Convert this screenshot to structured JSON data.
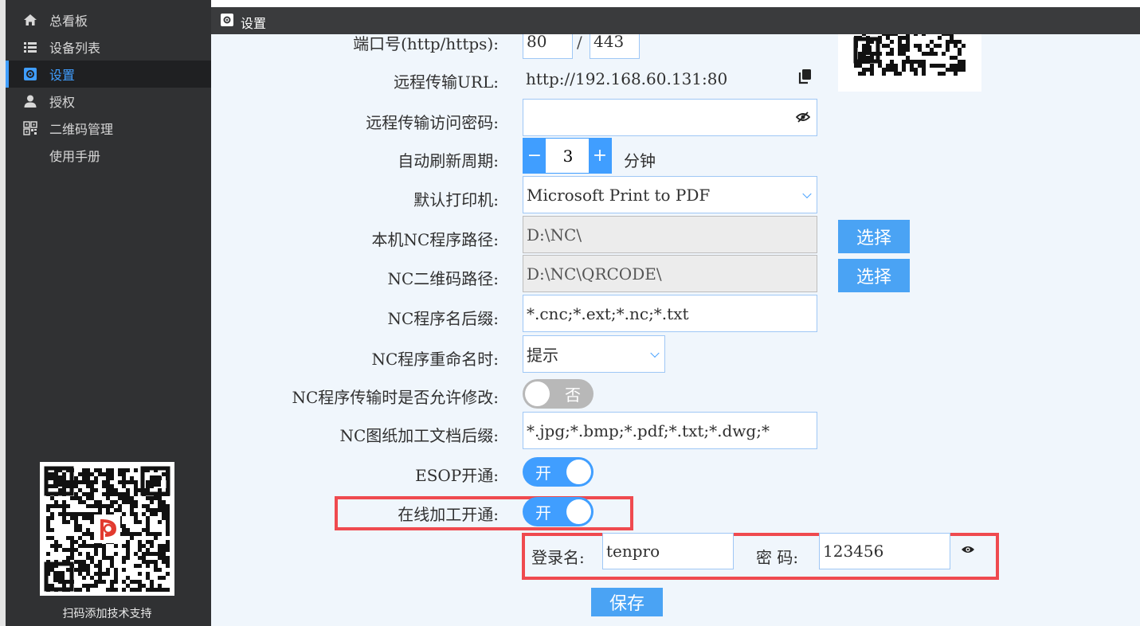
{
  "sidebar": {
    "items": [
      {
        "label": "总看板",
        "icon": "home-icon"
      },
      {
        "label": "设备列表",
        "icon": "list-icon"
      },
      {
        "label": "设置",
        "icon": "gear-icon",
        "active": true
      },
      {
        "label": "授权",
        "icon": "user-icon"
      },
      {
        "label": "二维码管理",
        "icon": "qrcode-icon"
      },
      {
        "label": "使用手册",
        "icon": ""
      }
    ],
    "qr_caption": "扫码添加技术支持"
  },
  "header": {
    "title": "设置"
  },
  "form": {
    "port": {
      "label": "端口号(http/https):",
      "http": "80",
      "sep": "/",
      "https": "443"
    },
    "remote_url": {
      "label": "远程传输URL:",
      "value": "http://192.168.60.131:80"
    },
    "remote_password": {
      "label": "远程传输访问密码:",
      "value": ""
    },
    "refresh": {
      "label": "自动刷新周期:",
      "value": "3",
      "unit": "分钟",
      "minus": "−",
      "plus": "+"
    },
    "printer": {
      "label": "默认打印机:",
      "value": "Microsoft Print to PDF"
    },
    "nc_path": {
      "label": "本机NC程序路径:",
      "value": "D:\\NC\\",
      "button": "选择"
    },
    "qr_path": {
      "label": "NC二维码路径:",
      "value": "D:\\NC\\QRCODE\\",
      "button": "选择"
    },
    "suffix": {
      "label": "NC程序名后缀:",
      "value": "*.cnc;*.ext;*.nc;*.txt"
    },
    "rename": {
      "label": "NC程序重命名时:",
      "value": "提示"
    },
    "allow_modify": {
      "label": "NC程序传输时是否允许修改:",
      "state": "否",
      "on": false
    },
    "doc_suffix": {
      "label": "NC图纸加工文档后缀:",
      "value": "*.jpg;*.bmp;*.pdf;*.txt;*.dwg;*"
    },
    "esop": {
      "label": "ESOP开通:",
      "state": "开",
      "on": true
    },
    "online": {
      "label": "在线加工开通:",
      "state": "开",
      "on": true
    },
    "login": {
      "label": "登录名:",
      "value": "tenpro"
    },
    "password": {
      "label": "密 码:",
      "value": "123456"
    },
    "save": "保存"
  },
  "colors": {
    "accent": "#409eff",
    "highlight": "#ef4a4f",
    "sidebar": "#303133"
  }
}
